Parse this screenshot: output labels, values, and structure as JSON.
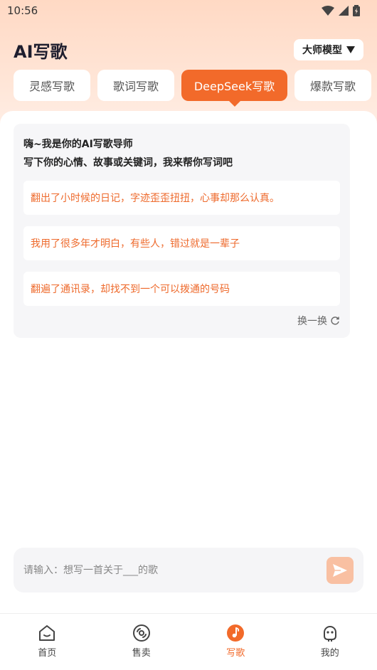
{
  "status": {
    "time": "10:56"
  },
  "header": {
    "title": "AI写歌",
    "model_label": "大师模型"
  },
  "tabs": [
    {
      "label": "灵感写歌",
      "active": false
    },
    {
      "label": "歌词写歌",
      "active": false
    },
    {
      "label": "DeepSeek写歌",
      "active": true
    },
    {
      "label": "爆款写歌",
      "active": false
    }
  ],
  "card": {
    "greeting_line1": "嗨~我是你的AI写歌导师",
    "greeting_line2": "写下你的心情、故事或关键词，我来帮你写词吧",
    "suggestions": [
      "翻出了小时候的日记，字迹歪歪扭扭，心事却那么认真。",
      "我用了很多年才明白，有些人，错过就是一辈子",
      "翻遍了通讯录，却找不到一个可以拨通的号码"
    ],
    "refresh_label": "换一换"
  },
  "input": {
    "placeholder": "请输入：想写一首关于___的歌",
    "value": ""
  },
  "nav": [
    {
      "label": "首页",
      "icon": "home-icon",
      "active": false
    },
    {
      "label": "售卖",
      "icon": "disc-icon",
      "active": false
    },
    {
      "label": "写歌",
      "icon": "write-song-icon",
      "active": true
    },
    {
      "label": "我的",
      "icon": "profile-icon",
      "active": false
    }
  ],
  "colors": {
    "accent": "#f26a2a",
    "accent_light": "#f9c0a2",
    "suggest_text": "#ee6a2c"
  }
}
